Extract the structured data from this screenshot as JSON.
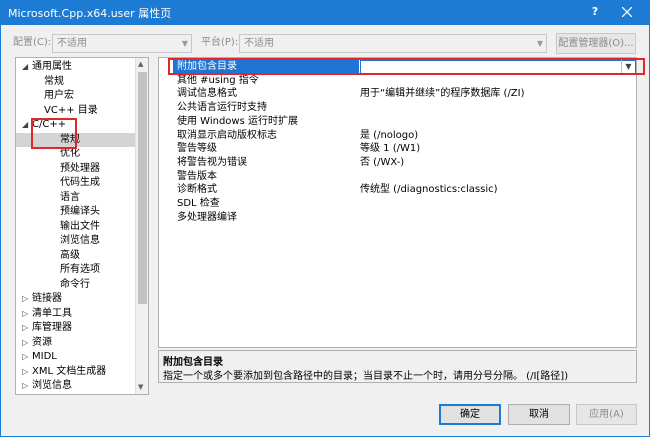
{
  "window": {
    "title": "Microsoft.Cpp.x64.user 属性页",
    "help_label": "?",
    "close_icon": "close-icon"
  },
  "config_bar": {
    "configuration_label": "配置(C):",
    "configuration_value": "不适用",
    "platform_label": "平台(P):",
    "platform_value": "不适用",
    "config_manager_label": "配置管理器(O)..."
  },
  "tree": {
    "items": [
      {
        "label": "通用属性",
        "expander": "◢"
      },
      {
        "label": "常规"
      },
      {
        "label": "用户宏"
      },
      {
        "label": "VC++ 目录"
      },
      {
        "label": "C/C++",
        "expander": "◢"
      },
      {
        "label": "常规",
        "selected": true
      },
      {
        "label": "优化"
      },
      {
        "label": "预处理器"
      },
      {
        "label": "代码生成"
      },
      {
        "label": "语言"
      },
      {
        "label": "预编译头"
      },
      {
        "label": "输出文件"
      },
      {
        "label": "浏览信息"
      },
      {
        "label": "高级"
      },
      {
        "label": "所有选项"
      },
      {
        "label": "命令行"
      },
      {
        "label": "链接器",
        "expander": "▷"
      },
      {
        "label": "清单工具",
        "expander": "▷"
      },
      {
        "label": "库管理器",
        "expander": "▷"
      },
      {
        "label": "资源",
        "expander": "▷"
      },
      {
        "label": "MIDL",
        "expander": "▷"
      },
      {
        "label": "XML 文档生成器",
        "expander": "▷"
      },
      {
        "label": "浏览信息",
        "expander": "▷"
      }
    ]
  },
  "properties": [
    {
      "name": "附加包含目录",
      "value": "",
      "selected": true
    },
    {
      "name": "其他 #using 指令",
      "value": ""
    },
    {
      "name": "调试信息格式",
      "value": "用于“编辑并继续”的程序数据库 (/ZI)"
    },
    {
      "name": "公共语言运行时支持",
      "value": ""
    },
    {
      "name": "使用 Windows 运行时扩展",
      "value": ""
    },
    {
      "name": "取消显示启动版权标志",
      "value": "是 (/nologo)"
    },
    {
      "name": "警告等级",
      "value": "等级 1 (/W1)"
    },
    {
      "name": "将警告视为错误",
      "value": "否 (/WX-)"
    },
    {
      "name": "警告版本",
      "value": ""
    },
    {
      "name": "诊断格式",
      "value": "传统型 (/diagnostics:classic)"
    },
    {
      "name": "SDL 检查",
      "value": ""
    },
    {
      "name": "多处理器编译",
      "value": ""
    }
  ],
  "description": {
    "title": "附加包含目录",
    "text": "指定一个或多个要添加到包含路径中的目录；当目录不止一个时，请用分号分隔。      (/I[路径])"
  },
  "buttons": {
    "ok": "确定",
    "cancel": "取消",
    "apply": "应用(A)"
  },
  "colors": {
    "titlebar": "#1e7bd3",
    "selection": "#1f74d4",
    "highlight_box": "#e0282c"
  }
}
